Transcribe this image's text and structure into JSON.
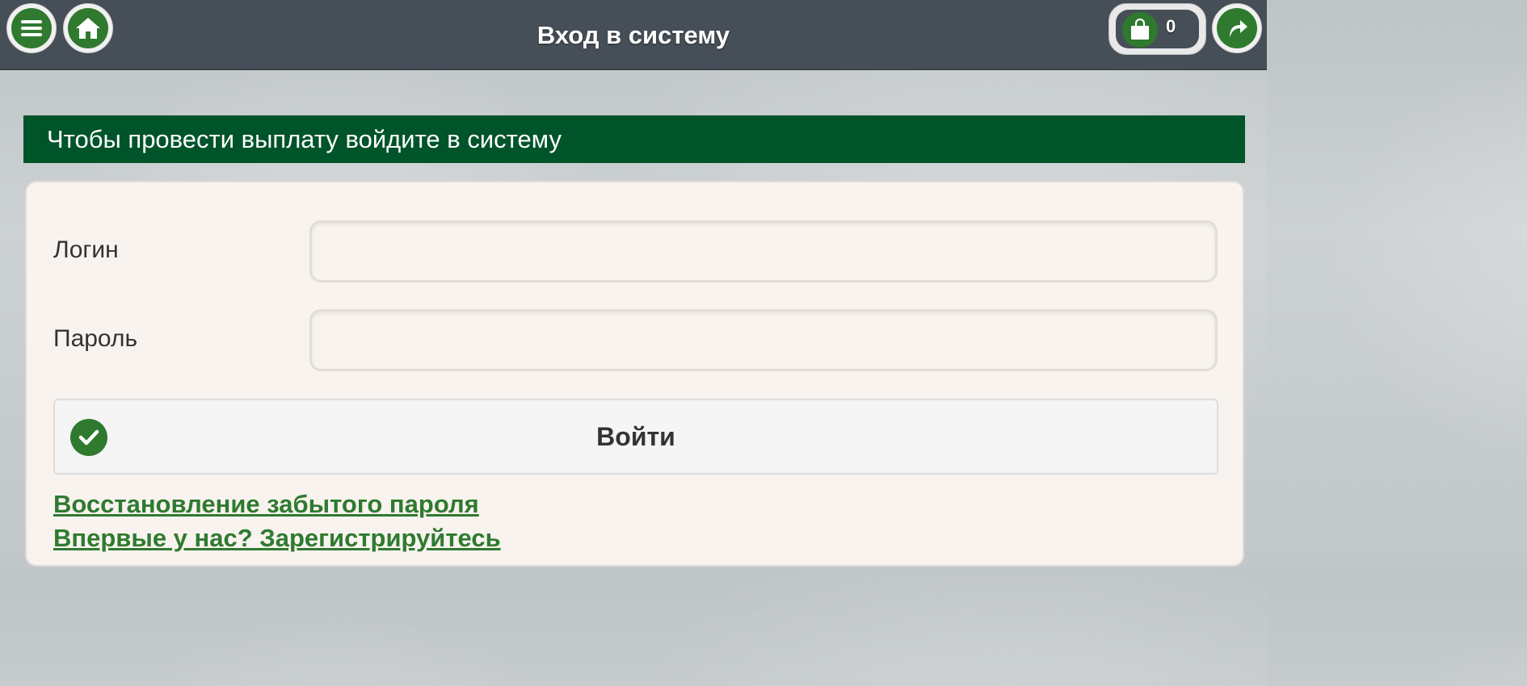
{
  "header": {
    "title": "Вход в систему",
    "menu_icon": "hamburger-menu-icon",
    "home_icon": "home-icon",
    "share_icon": "share-arrow-icon",
    "cart": {
      "icon": "shopping-bag-icon",
      "count": "0"
    }
  },
  "notice": {
    "text": "Чтобы провести выплату войдите в систему"
  },
  "form": {
    "login_label": "Логин",
    "login_value": "",
    "password_label": "Пароль",
    "password_value": "",
    "submit_label": "Войти",
    "submit_icon": "checkmark-icon"
  },
  "links": {
    "recover_password": "Восстановление забытого пароля",
    "register": "Впервые у нас? Зарегистрируйтесь"
  },
  "colors": {
    "header_bg": "#464f57",
    "accent_green": "#2f7a2f",
    "notice_bg": "#00542a",
    "panel_bg": "#f8f3ef"
  }
}
